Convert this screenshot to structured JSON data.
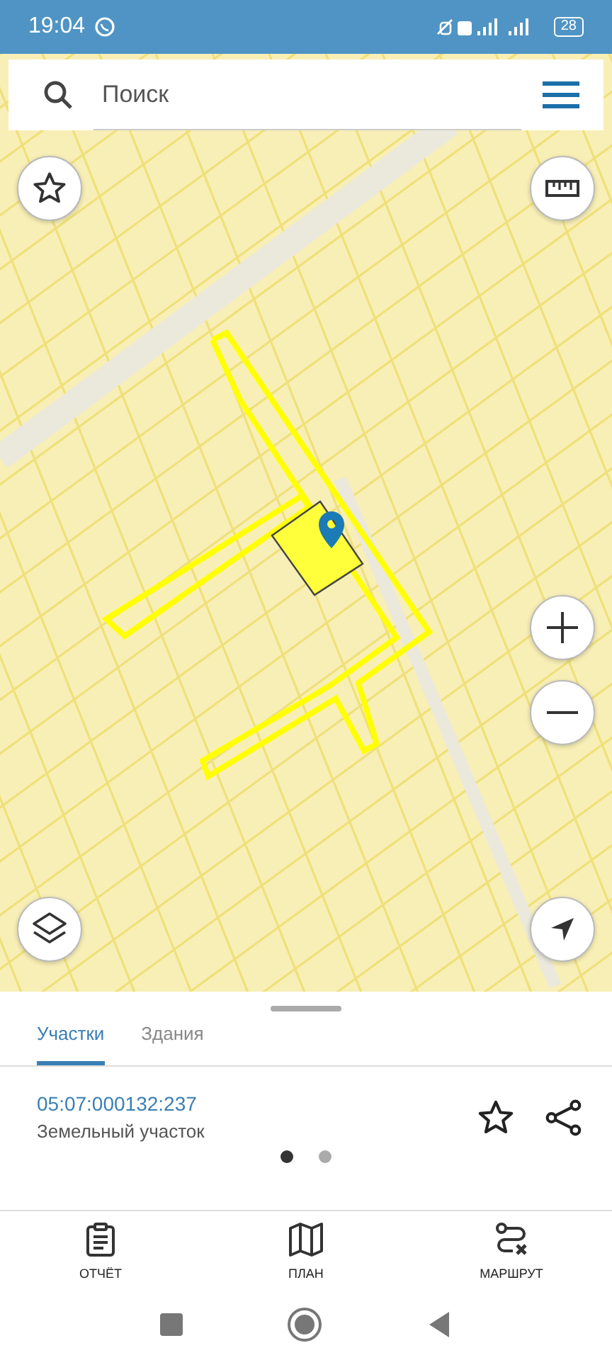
{
  "status_bar": {
    "time": "19:04",
    "battery": "28"
  },
  "search": {
    "placeholder": "Поиск"
  },
  "sheet": {
    "tabs": [
      {
        "label": "Участки",
        "selected": true
      },
      {
        "label": "Здания",
        "selected": false
      }
    ],
    "parcel": {
      "number": "05:07:000132:237",
      "type": "Земельный участок"
    },
    "pager": [
      {
        "selected": true
      },
      {
        "selected": false
      }
    ]
  },
  "bottom_nav": [
    {
      "kind": "report",
      "label": "ОТЧЁТ"
    },
    {
      "kind": "plan",
      "label": "ПЛАН"
    },
    {
      "kind": "route",
      "label": "МАРШРУТ"
    }
  ]
}
